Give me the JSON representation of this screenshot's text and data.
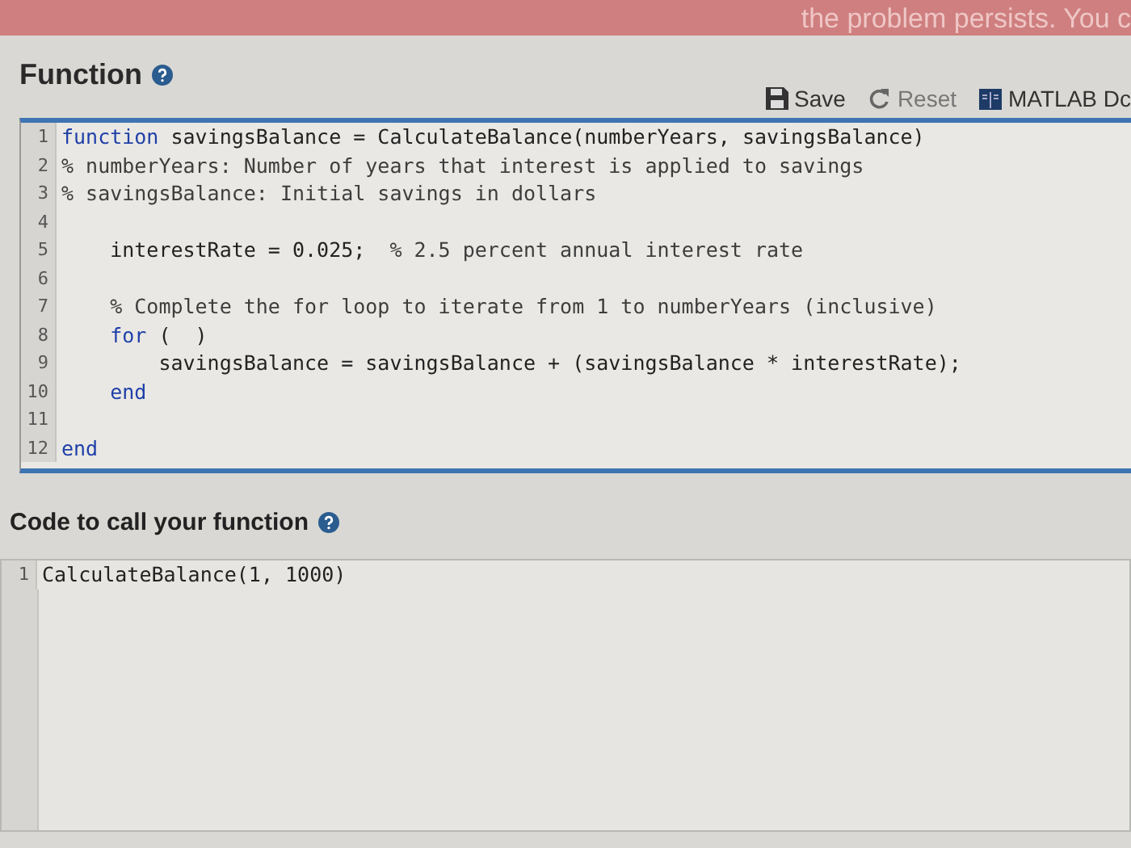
{
  "banner": {
    "text": "the problem persists. You c"
  },
  "function_section": {
    "title": "Function",
    "toolbar": [
      {
        "kind": "save",
        "label": "Save",
        "disabled": false
      },
      {
        "kind": "reset",
        "label": "Reset",
        "disabled": true
      },
      {
        "kind": "docs",
        "label": "MATLAB Dc",
        "disabled": false
      }
    ],
    "editor": {
      "lines": [
        {
          "number": "1",
          "segments": [
            {
              "kind": "keyword",
              "text": "function"
            },
            {
              "kind": "plain",
              "text": " savingsBalance = CalculateBalance(numberYears, savingsBalance)"
            }
          ]
        },
        {
          "number": "2",
          "segments": [
            {
              "kind": "comment",
              "text": "% numberYears: Number of years that interest is applied to savings"
            }
          ]
        },
        {
          "number": "3",
          "segments": [
            {
              "kind": "comment",
              "text": "% savingsBalance: Initial savings in dollars"
            }
          ]
        },
        {
          "number": "4"
        },
        {
          "number": "5",
          "segments": [
            {
              "kind": "plain",
              "text": "    interestRate = 0.025;  "
            },
            {
              "kind": "comment",
              "text": "% 2.5 percent annual interest rate"
            }
          ]
        },
        {
          "number": "6"
        },
        {
          "number": "7",
          "segments": [
            {
              "kind": "comment",
              "text": "    % Complete the for loop to iterate from 1 to numberYears (inclusive)"
            }
          ]
        },
        {
          "number": "8",
          "segments": [
            {
              "kind": "keyword",
              "text": "    for"
            },
            {
              "kind": "plain",
              "text": " (  )"
            }
          ]
        },
        {
          "number": "9",
          "segments": [
            {
              "kind": "plain",
              "text": "        savingsBalance = savingsBalance + (savingsBalance * interestRate);"
            }
          ]
        },
        {
          "number": "10",
          "segments": [
            {
              "kind": "keyword",
              "text": "    end"
            }
          ]
        },
        {
          "number": "11"
        },
        {
          "number": "12",
          "segments": [
            {
              "kind": "keyword",
              "text": "end"
            }
          ]
        }
      ]
    }
  },
  "call_section": {
    "title": "Code to call your function",
    "editor": {
      "lines": [
        {
          "number": "1",
          "segments": [
            {
              "kind": "plain",
              "text": "CalculateBalance(1, 1000)"
            }
          ]
        }
      ]
    }
  }
}
